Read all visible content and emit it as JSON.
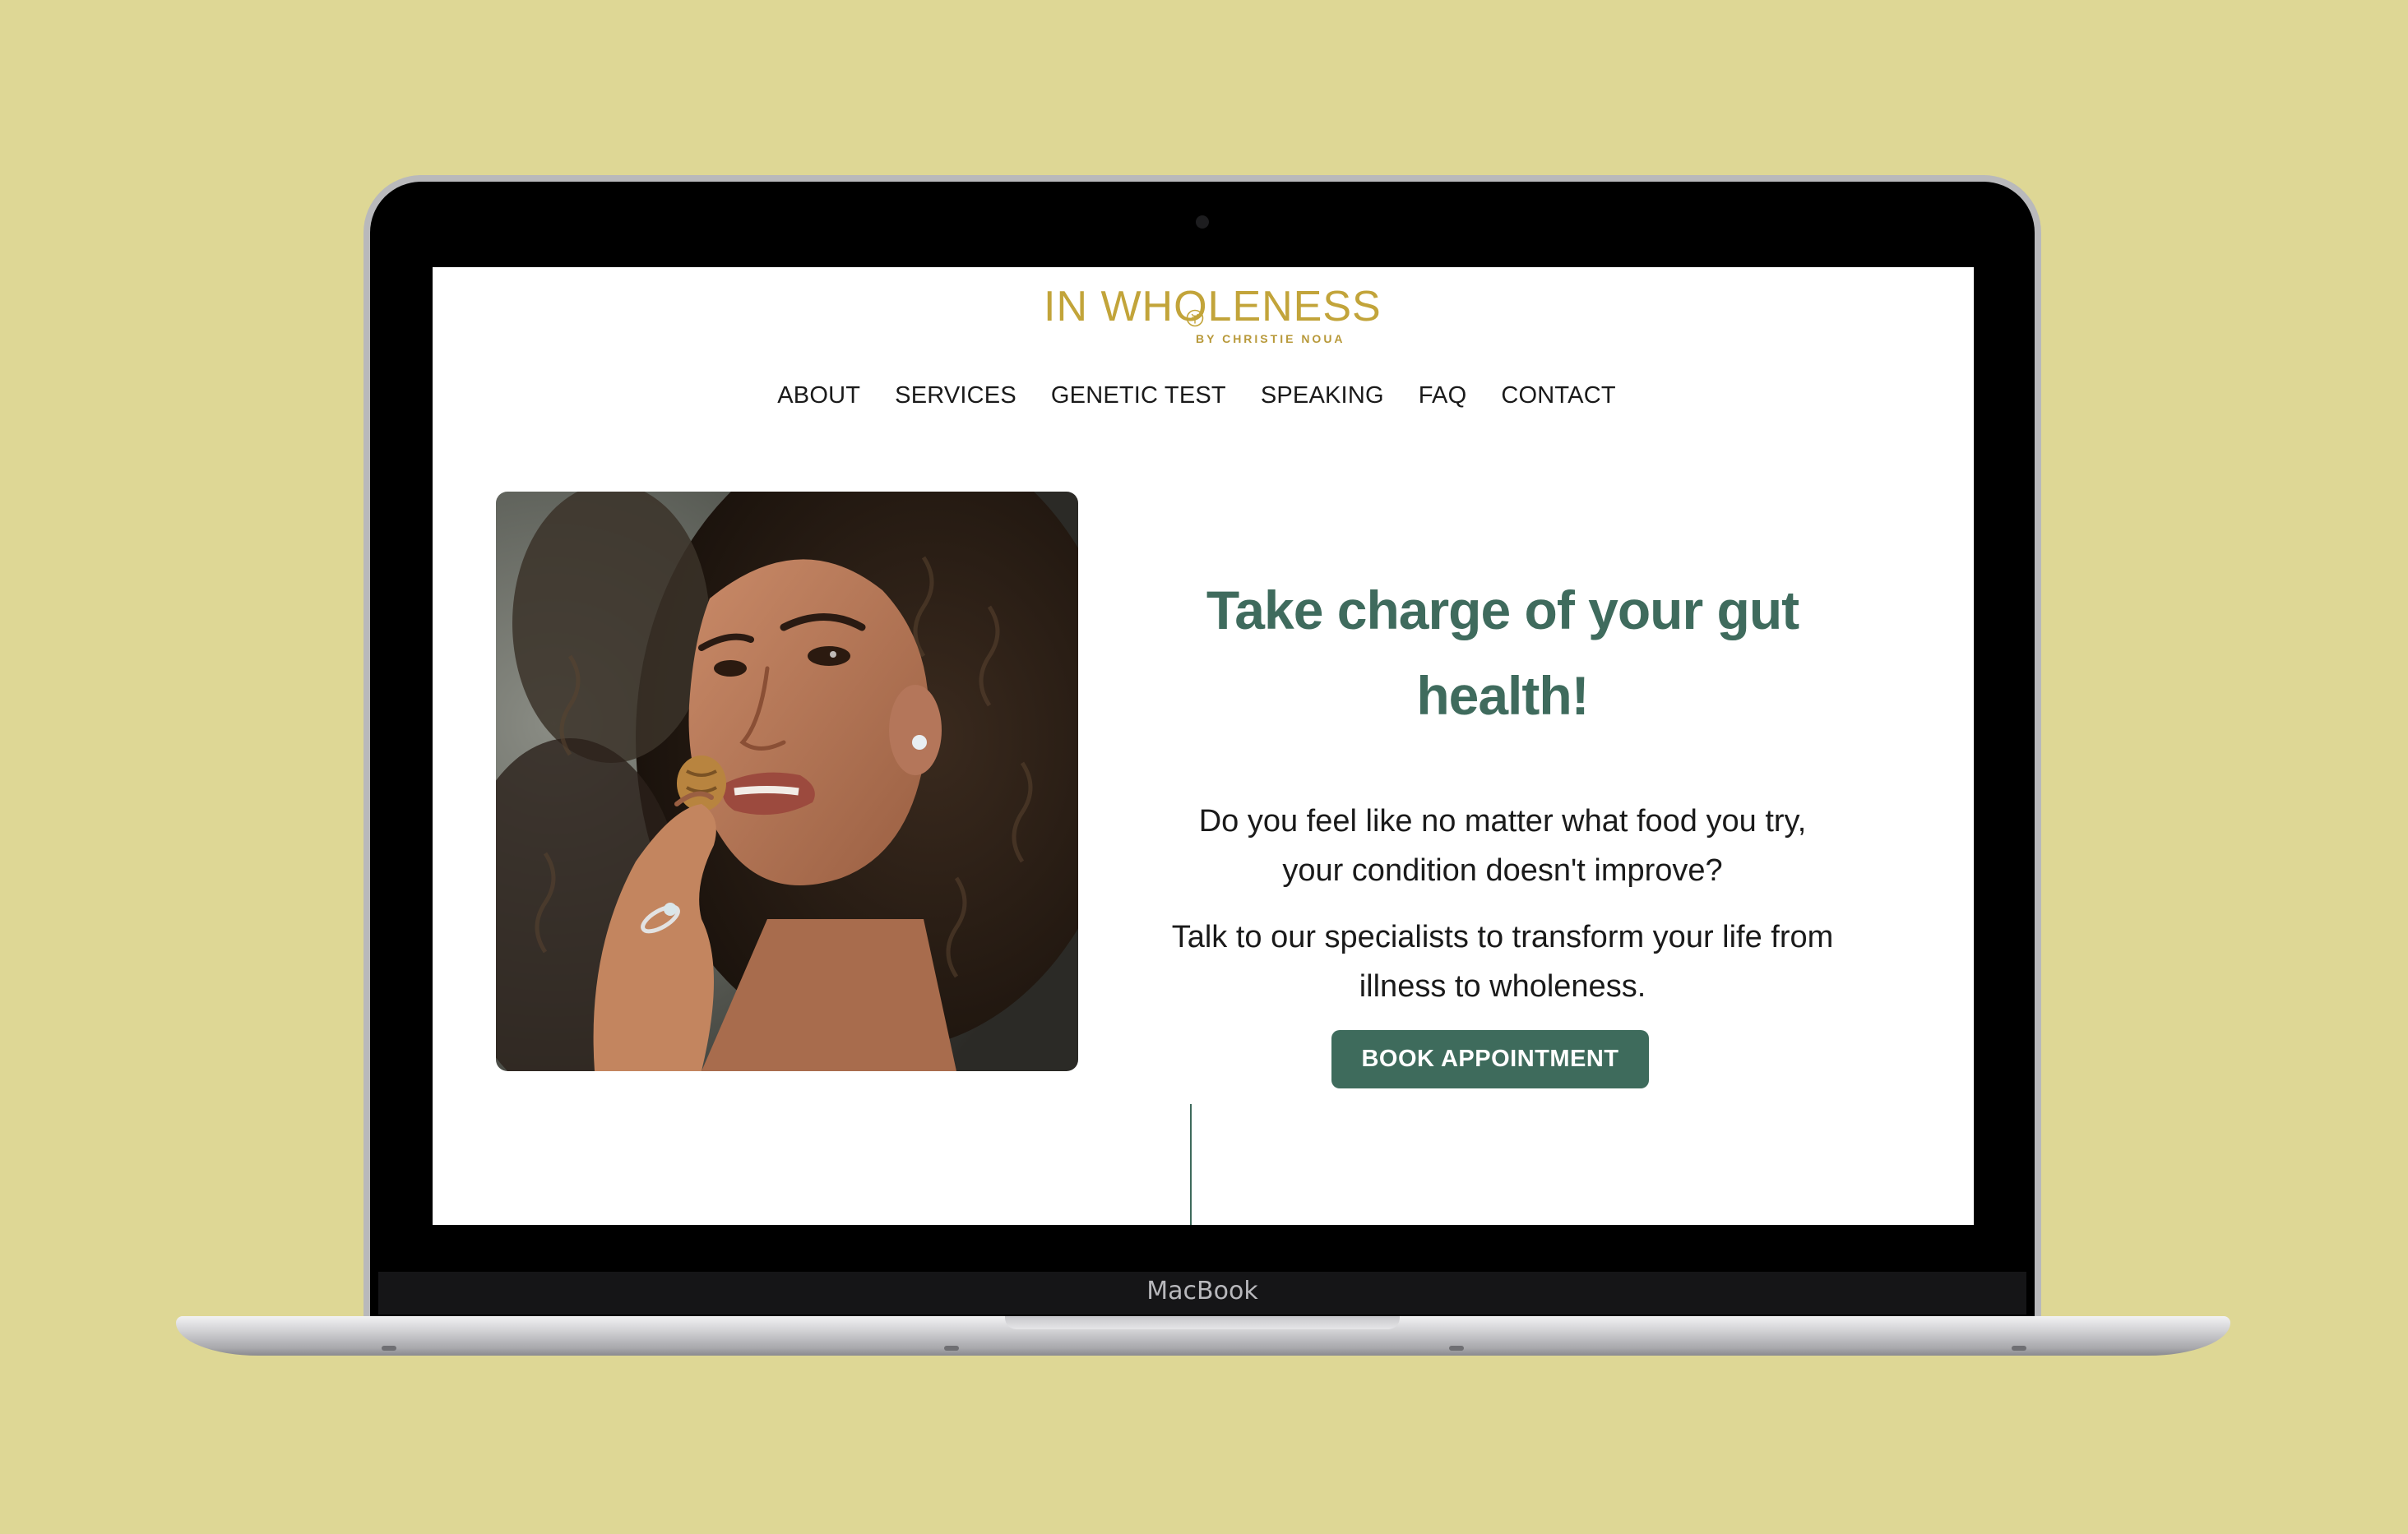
{
  "device": {
    "brand_label": "MacBook"
  },
  "site": {
    "logo": {
      "main_text": "IN WHOLENESS",
      "tagline": "BY CHRISTIE NOUA"
    },
    "nav": {
      "items": [
        {
          "label": "ABOUT"
        },
        {
          "label": "SERVICES"
        },
        {
          "label": "GENETIC TEST"
        },
        {
          "label": "SPEAKING"
        },
        {
          "label": "FAQ"
        },
        {
          "label": "CONTACT"
        }
      ]
    },
    "hero": {
      "headline_line1": "Take charge of your gut",
      "headline_line2": "health!",
      "paragraph_1": "Do you feel like no matter what food you try, your condition doesn't improve?",
      "paragraph_2": "Talk to our specialists to transform your life from illness to wholeness.",
      "cta_label": "BOOK APPOINTMENT"
    }
  },
  "colors": {
    "background": "#ded795",
    "brand_gold": "#c2a43a",
    "accent_green": "#3e6b5c",
    "headline_green": "#3f6b5d"
  }
}
